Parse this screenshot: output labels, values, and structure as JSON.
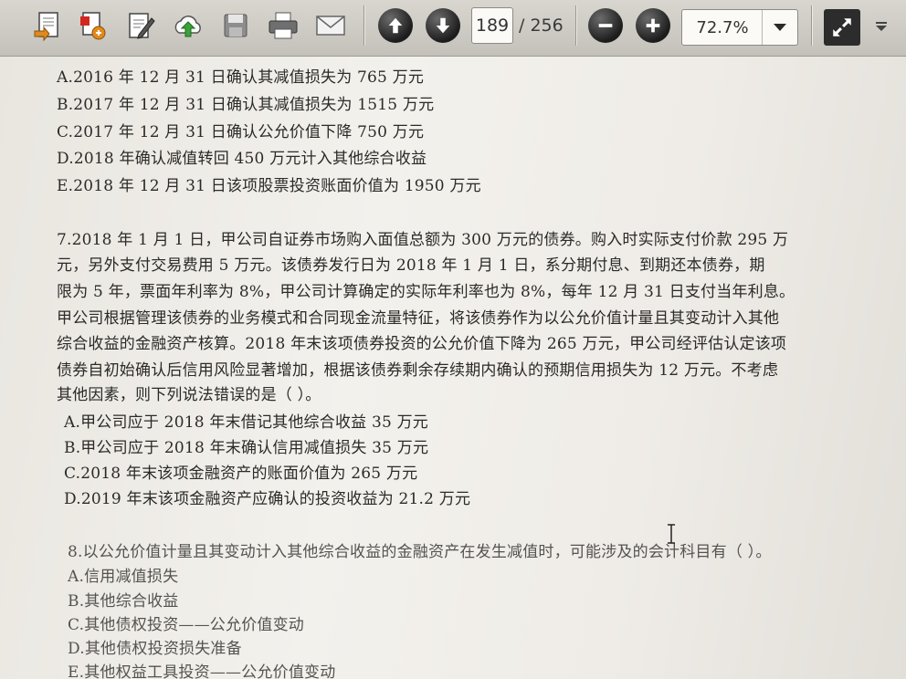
{
  "toolbar": {
    "icons": [
      "open-file-icon",
      "export-icon",
      "edit-icon",
      "upload-cloud-icon",
      "save-icon",
      "print-icon",
      "email-icon",
      "previous-page-icon",
      "next-page-icon",
      "zoom-out-icon",
      "zoom-in-icon",
      "fullscreen-icon",
      "more-options-icon"
    ],
    "page_current": "189",
    "page_total": "/ 256",
    "zoom": "72.7%"
  },
  "document": {
    "lines": [
      "A.2016 年 12 月 31 日确认其减值损失为 765 万元",
      "B.2017 年 12 月 31 日确认其减值损失为 1515 万元",
      "C.2017 年 12 月 31 日确认公允价值下降 750 万元",
      "D.2018 年确认减值转回 450 万元计入其他综合收益",
      "E.2018 年 12 月 31 日该项股票投资账面价值为 1950 万元",
      "7.2018 年 1 月 1 日，甲公司自证券市场购入面值总额为 300 万元的债券。购入时实际支付价款 295 万",
      "元，另外支付交易费用 5 万元。该债券发行日为 2018 年 1 月 1 日，系分期付息、到期还本债券，期",
      "限为 5 年，票面年利率为 8%，甲公司计算确定的实际年利率也为 8%，每年 12 月 31 日支付当年利息。",
      "甲公司根据管理该债券的业务模式和合同现金流量特征，将该债券作为以公允价值计量且其变动计入其他",
      "综合收益的金融资产核算。2018 年末该项债券投资的公允价值下降为 265 万元，甲公司经评估认定该项",
      "债券自初始确认后信用风险显著增加，根据该债券剩余存续期内确认的预期信用损失为 12 万元。不考虑",
      "其他因素，则下列说法错误的是（ ）。",
      "A.甲公司应于 2018 年末借记其他综合收益 35 万元",
      "B.甲公司应于 2018 年末确认信用减值损失 35 万元",
      "C.2018 年末该项金融资产的账面价值为 265 万元",
      "D.2019 年末该项金融资产应确认的投资收益为 21.2 万元",
      "8.以公允价值计量且其变动计入其他综合收益的金融资产在发生减值时，可能涉及的会计科目有（ ）。",
      "A.信用减值损失",
      "B.其他综合收益",
      "C.其他债权投资——公允价值变动",
      "D.其他债权投资损失准备",
      "E.其他权益工具投资——公允价值变动"
    ]
  }
}
